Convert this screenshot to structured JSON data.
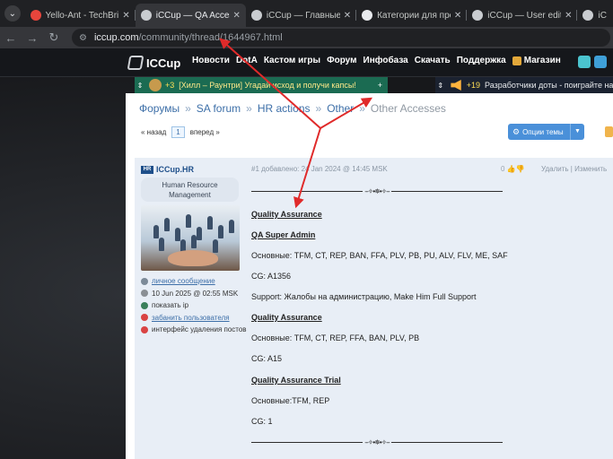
{
  "browser": {
    "tabs": [
      {
        "title": "Yello-Ant - TechBringer",
        "favicon_color": "#e8453c"
      },
      {
        "title": "iCCup — QA Accesses",
        "favicon_color": "#c9ccd0",
        "active": true
      },
      {
        "title": "iCCup — Главные фор",
        "favicon_color": "#c9ccd0"
      },
      {
        "title": "Категории для профил",
        "favicon_color": "#e8eaed"
      },
      {
        "title": "iCCup — User edit",
        "favicon_color": "#c9ccd0"
      },
      {
        "title": "iC",
        "favicon_color": "#c9ccd0"
      }
    ],
    "url_host": "iccup.com",
    "url_path": "/community/thread/1644967.html"
  },
  "site": {
    "logo": "ICCup",
    "nav": [
      "Новости",
      "DotA",
      "Кастом игры",
      "Форум",
      "Инфобаза",
      "Скачать",
      "Поддержка"
    ],
    "shop_label": "Магазин",
    "ticker_left": {
      "count": "+3",
      "text": "[Хилл – Раунтри] Угадай исход и получи капсы!",
      "plus": "+"
    },
    "ticker_right": {
      "count": "+19",
      "text": "Разработчики доты - поиграйте на р"
    }
  },
  "breadcrumbs": [
    "Форумы",
    "SA forum",
    "HR actions",
    "Other",
    "Other Accesses"
  ],
  "breadcrumb_sep": "»",
  "pager": {
    "prev": "« назад",
    "page": "1",
    "next": "вперед »"
  },
  "options_button": "Опции темы",
  "post": {
    "author": "ICCup.HR",
    "role_line1": "Human Resource",
    "role_line2": "Management",
    "actions": [
      {
        "text": "личное сообщение",
        "color": "#7c8a98",
        "link": true
      },
      {
        "text": "10 Jun 2025 @ 02:55 MSK",
        "color": "#8a8f94",
        "link": false
      },
      {
        "text": "показать ip",
        "color": "#3a7f5a",
        "link": false
      },
      {
        "text": "забанить пользователя",
        "color": "#d94343",
        "link": true
      },
      {
        "text": "интерфейс удаления постов",
        "color": "#d94343",
        "link": false
      }
    ],
    "meta": "#1 добавлено: 24 Jan 2024 @ 14:45 MSK",
    "rating": "0",
    "delete_label": "Удалить",
    "edit_label": "Изменить",
    "divider_ornament": "--✧•✵•✧--",
    "body": {
      "h1": "Quality Assurance",
      "h2": "QA Super Admin",
      "l1": "Основные: TFM, CT, REP, BAN, FFA, PLV, PB, PU, ALV, FLV, ME, SAF",
      "l2": "CG: A1356",
      "l3": "Support: Жалобы на администрацию, Make Him Full Support",
      "h3": "Quality Assurance",
      "l4": "Основные: TFM, CT, REP, FFA, BAN, PLV, PB",
      "l5": "CG: A15",
      "h4": "Quality Assurance Trial",
      "l6": "Основные:TFM, REP",
      "l7": "CG: 1"
    }
  },
  "annotation_color": "#e02a2a"
}
